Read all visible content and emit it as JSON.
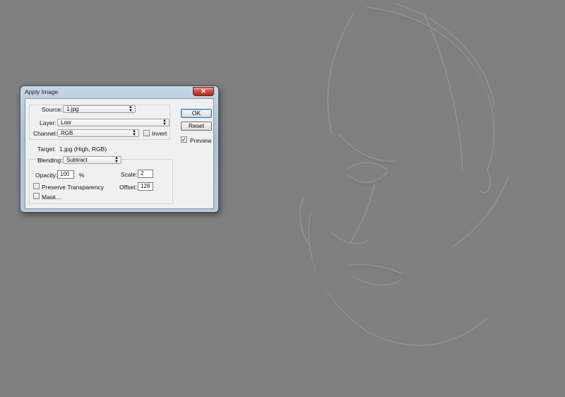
{
  "dialog": {
    "title": "Apply Image",
    "close_glyph": "✕"
  },
  "source": {
    "label": "Source:",
    "value": "1.jpg"
  },
  "layer": {
    "label": "Layer:",
    "value": "Low"
  },
  "channel": {
    "label": "Channel:",
    "value": "RGB"
  },
  "invert": {
    "label": "Invert",
    "checked": false
  },
  "target": {
    "label": "Target:",
    "value": "1.jpg (High, RGB)"
  },
  "blending": {
    "label": "Blending:",
    "value": "Subtract"
  },
  "opacity": {
    "label": "Opacity:",
    "value": "100",
    "unit": "%"
  },
  "scale": {
    "label": "Scale:",
    "value": "2"
  },
  "offset": {
    "label": "Offset:",
    "value": "128"
  },
  "preserve_transparency": {
    "label": "Preserve Transparency",
    "checked": false
  },
  "mask": {
    "label": "Mask...",
    "checked": false
  },
  "buttons": {
    "ok": "OK",
    "reset": "Reset"
  },
  "preview": {
    "label": "Preview",
    "checked": true,
    "check_glyph": "✓"
  }
}
